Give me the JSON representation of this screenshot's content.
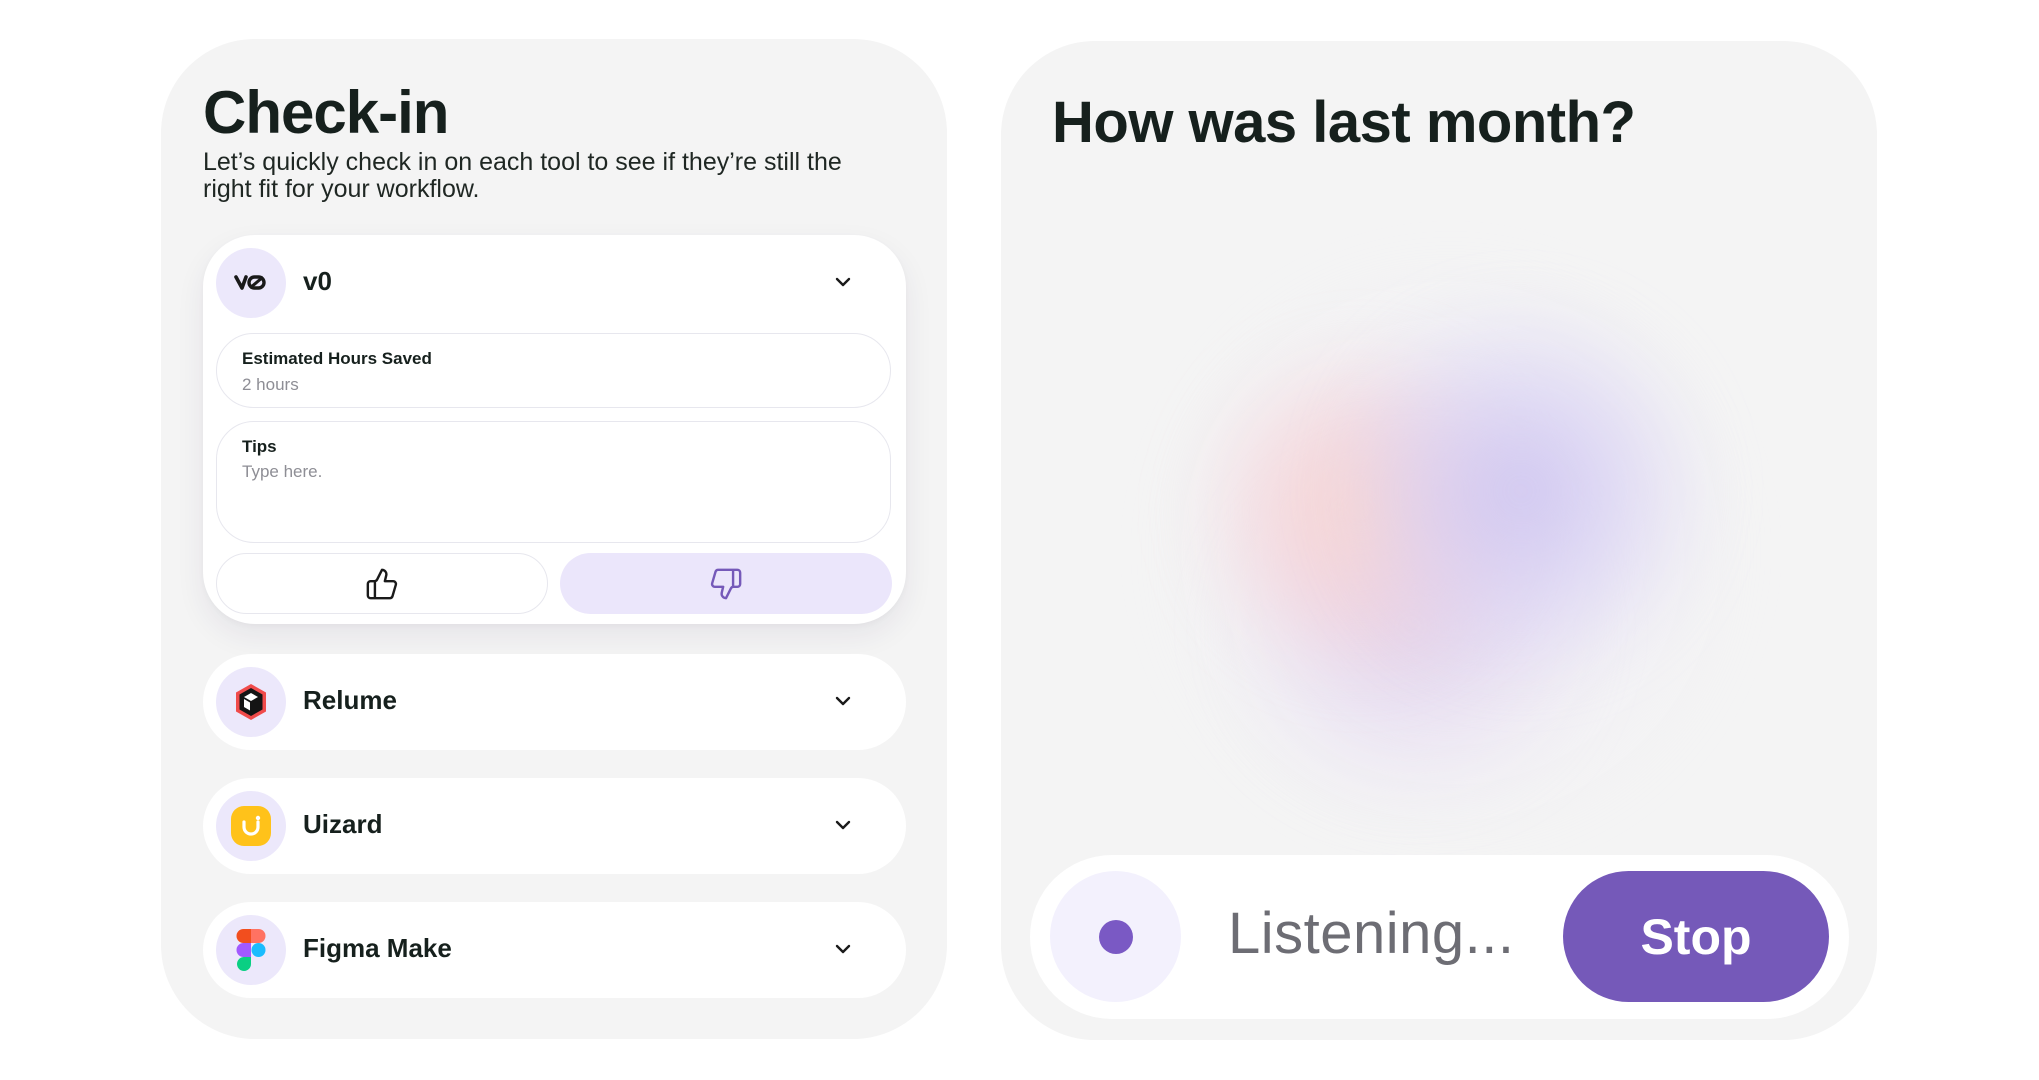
{
  "checkin": {
    "title": "Check-in",
    "subtitle": "Let’s quickly check in on each tool to see if they’re still the right fit for your workflow.",
    "tools": [
      {
        "name": "v0",
        "logo": "v0-logo",
        "expanded": true,
        "hours_label": "Estimated Hours Saved",
        "hours_value": "2 hours",
        "tips_label": "Tips",
        "tips_placeholder": "Type here.",
        "thumbs_up_icon": "thumbs-up-icon",
        "thumbs_down_icon": "thumbs-down-icon",
        "selected_vote": "thumbs-down"
      },
      {
        "name": "Relume",
        "logo": "relume-logo",
        "expanded": false
      },
      {
        "name": "Uizard",
        "logo": "uizard-logo",
        "expanded": false
      },
      {
        "name": "Figma Make",
        "logo": "figma-logo",
        "expanded": false
      }
    ]
  },
  "voice": {
    "question": "How was last month?",
    "status": "Listening...",
    "stop_label": "Stop"
  },
  "colors": {
    "accent": "#7559b9",
    "accent_light": "#ebe6fb",
    "panel_bg": "#f4f4f4",
    "text_dark": "#16201d"
  }
}
